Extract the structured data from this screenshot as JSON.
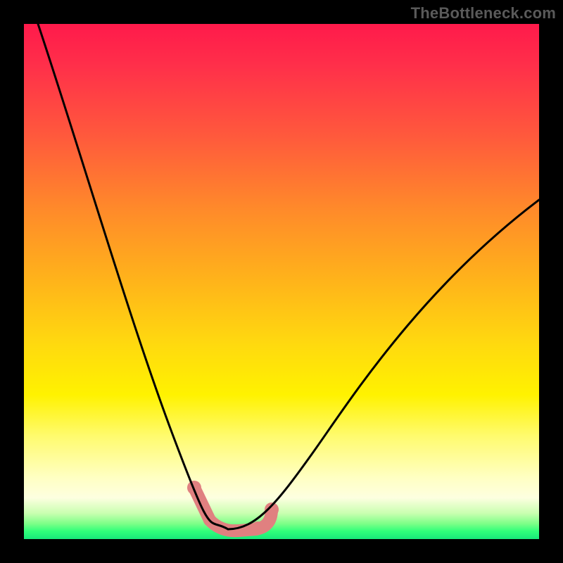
{
  "watermark": "TheBottleneck.com",
  "colors": {
    "background": "#000000",
    "gradient_top": "#ff1a4b",
    "gradient_mid": "#fff200",
    "gradient_bottom": "#18e87a",
    "curve": "#000000",
    "highlight": "#e08080"
  },
  "chart_data": {
    "type": "line",
    "title": "",
    "xlabel": "",
    "ylabel": "",
    "xlim": [
      0,
      100
    ],
    "ylim": [
      0,
      100
    ],
    "note": "Values are relative percentages of the plot area. x runs left→right, y runs top(100)→bottom(0). The curve is a V-shaped bottleneck profile with its minimum near x≈40; left branch is steeper than right.",
    "series": [
      {
        "name": "bottleneck-curve",
        "x": [
          3,
          10,
          17,
          24,
          30,
          34,
          37,
          40,
          44,
          48,
          55,
          65,
          75,
          85,
          95,
          100
        ],
        "y": [
          100,
          80,
          60,
          40,
          22,
          10,
          4,
          2,
          2,
          4,
          12,
          28,
          44,
          56,
          64,
          68
        ]
      }
    ],
    "highlight_region": {
      "name": "valley-highlight",
      "x": [
        33,
        36,
        40,
        44,
        48
      ],
      "y": [
        10,
        4,
        2,
        2,
        4
      ]
    }
  }
}
